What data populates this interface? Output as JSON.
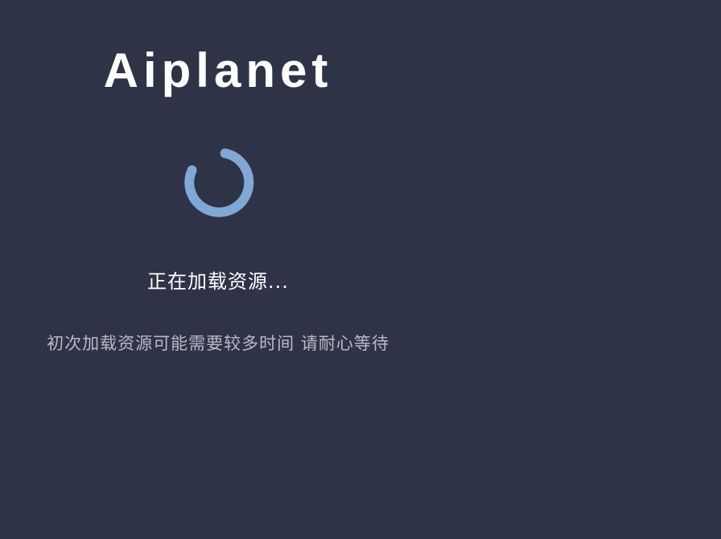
{
  "app": {
    "brand": "Aiplanet"
  },
  "loading": {
    "status_text": "正在加载资源...",
    "hint_text": "初次加载资源可能需要较多时间 请耐心等待",
    "spinner_icon": "loading-spinner-icon",
    "spinner_color": "#7fa8d6",
    "background_color": "#2f3347"
  }
}
